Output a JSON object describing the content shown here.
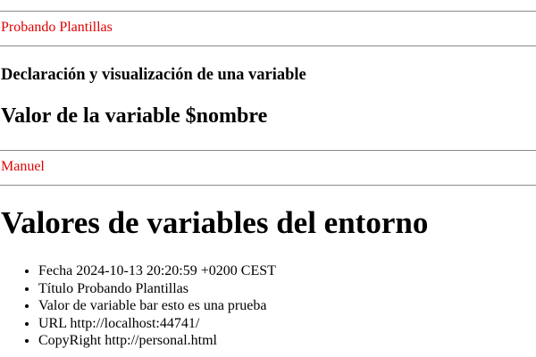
{
  "header": {
    "site_title": "Probando Plantillas"
  },
  "section": {
    "heading": "Declaración y visualización de una variable",
    "variable_heading": "Valor de la variable $nombre",
    "variable_value": "Manuel"
  },
  "environment": {
    "heading": "Valores de variables del entorno",
    "items": [
      "Fecha 2024-10-13 20:20:59 +0200 CEST",
      "Título Probando Plantillas",
      "Valor de variable bar esto es una prueba",
      "URL http://localhost:44741/",
      "CopyRight http://personal.html"
    ]
  },
  "colors": {
    "accent_text": "#e00000",
    "rule": "#8a8a8a"
  }
}
